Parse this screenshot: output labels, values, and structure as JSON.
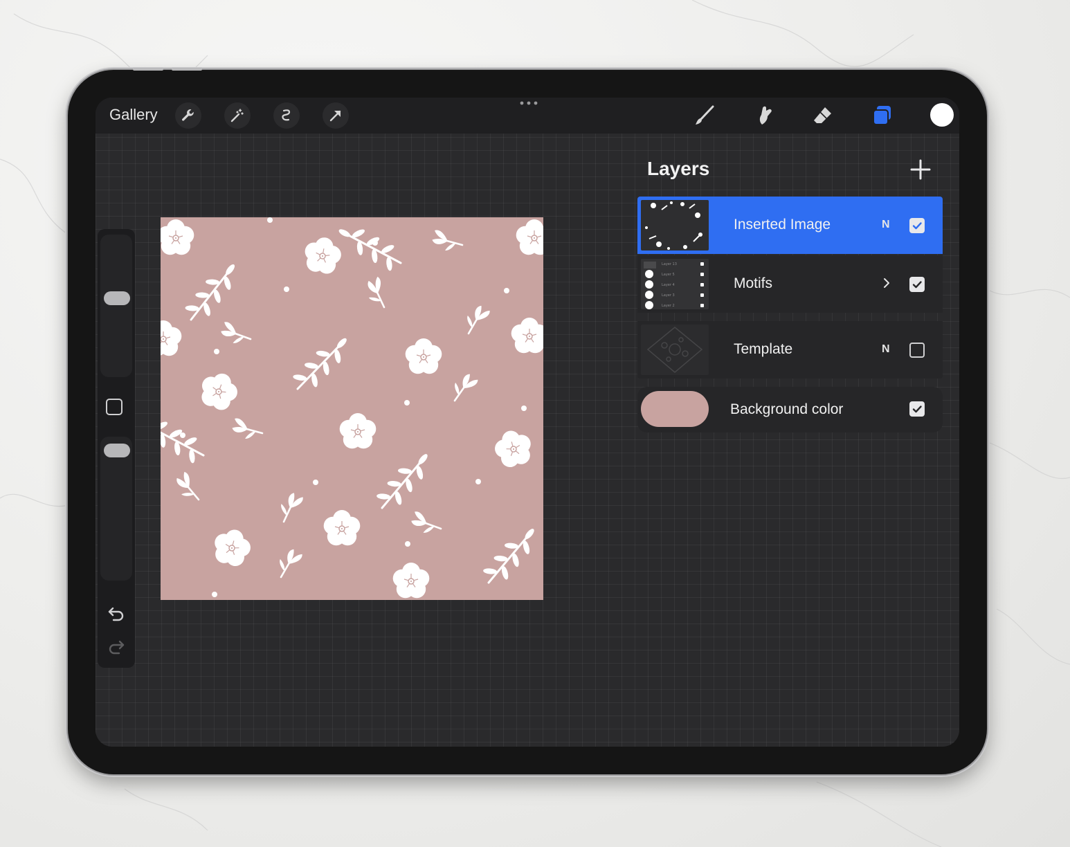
{
  "toolbar": {
    "gallery_label": "Gallery",
    "left_tools": [
      "wrench-icon",
      "magic-wand-icon",
      "selection-icon",
      "transform-arrow-icon"
    ],
    "right_tools": [
      "brush-icon",
      "smudge-icon",
      "eraser-icon",
      "layers-icon"
    ],
    "active_tool": "layers-icon",
    "current_color": "#ffffff",
    "accent": "#2f6ef2"
  },
  "canvas": {
    "background": "#c8a3a0",
    "motif_color": "#ffffff"
  },
  "layers": {
    "title": "Layers",
    "items": [
      {
        "name": "Inserted Image",
        "blend": "N",
        "visible": true,
        "active": true
      },
      {
        "name": "Motifs",
        "blend": "",
        "visible": true,
        "active": false,
        "is_group": true,
        "thumb_rows": [
          "Layer 13",
          "Layer 5",
          "Layer 4",
          "Layer 3",
          "Layer 2"
        ]
      },
      {
        "name": "Template",
        "blend": "N",
        "visible": false,
        "active": false
      }
    ],
    "background": {
      "name": "Background color",
      "color": "#c8a3a0",
      "visible": true
    }
  }
}
